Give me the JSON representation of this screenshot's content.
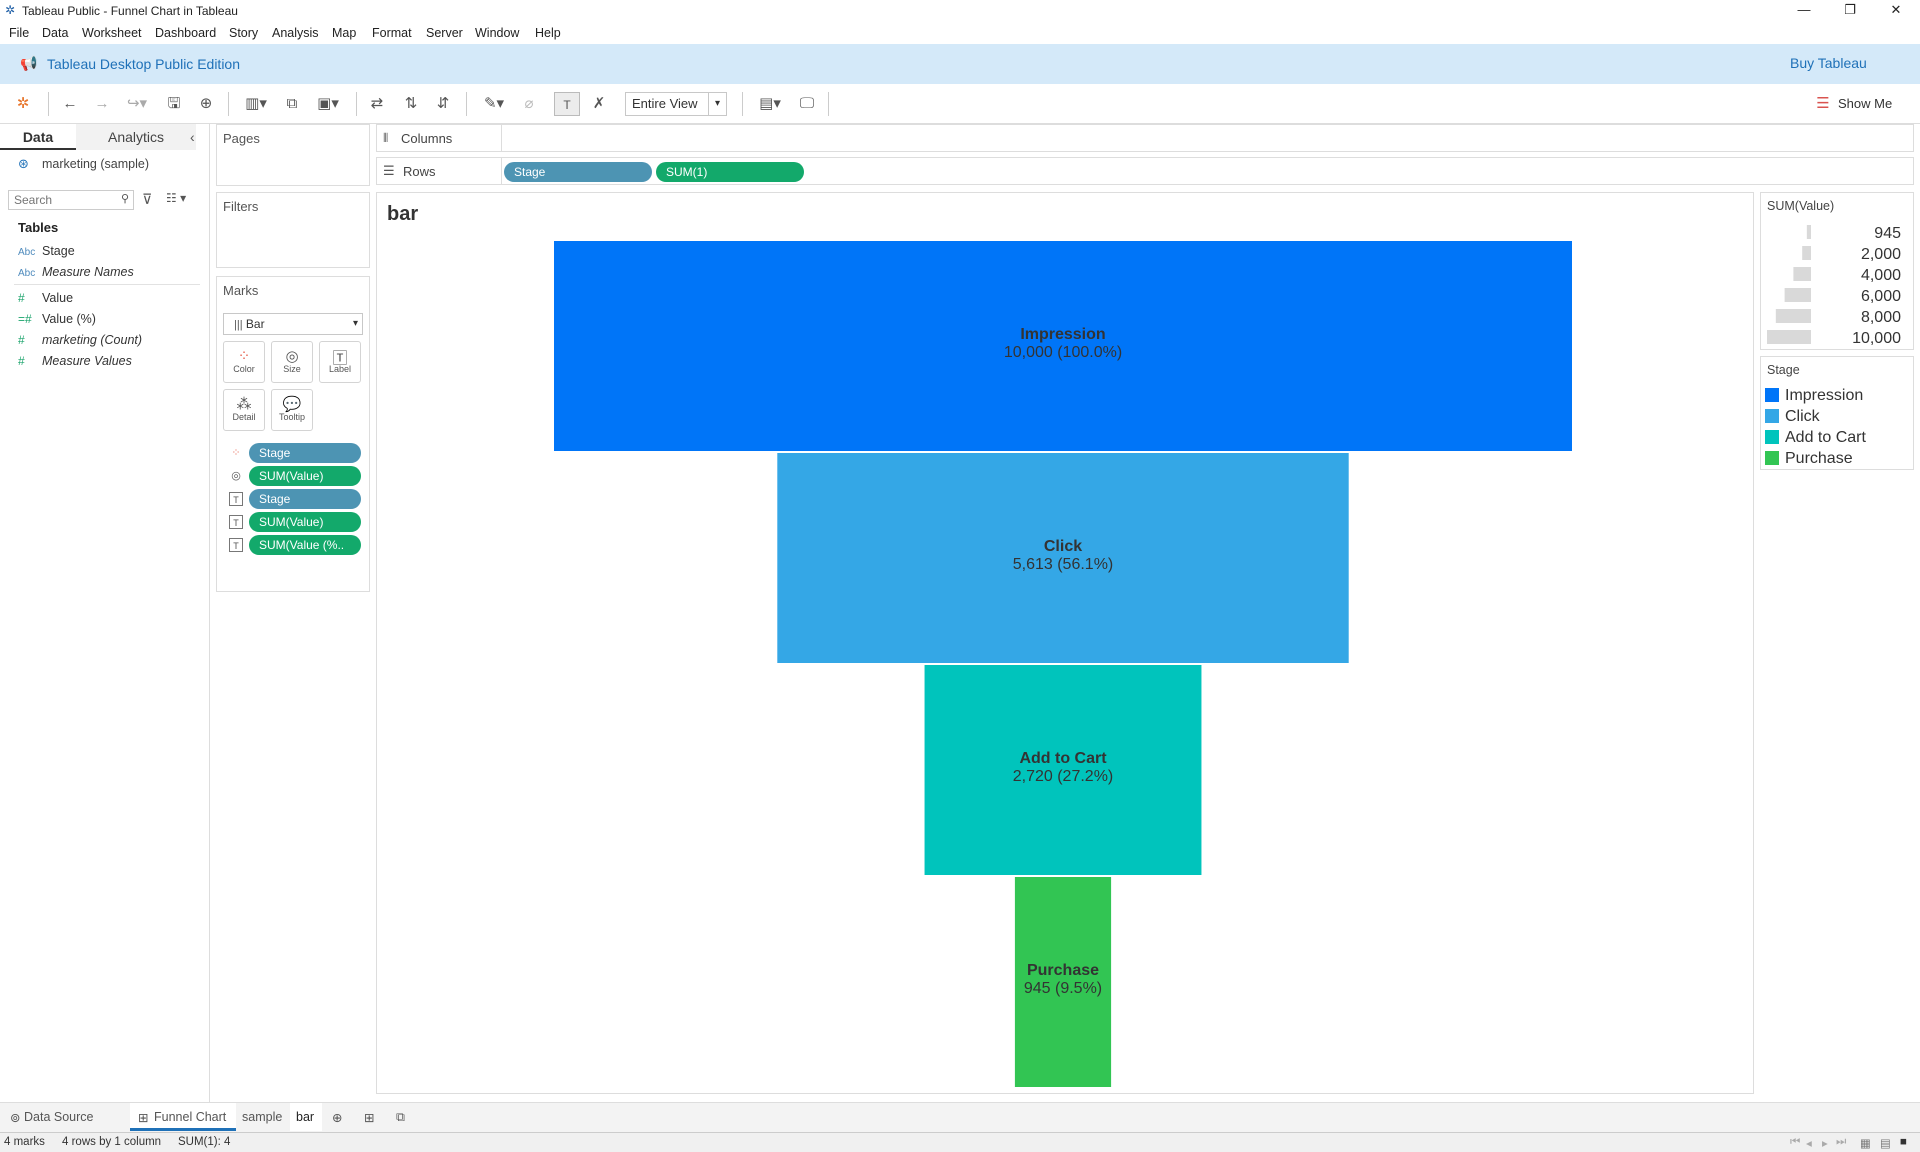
{
  "window": {
    "title": "Tableau Public - Funnel Chart in Tableau"
  },
  "menu": [
    "File",
    "Data",
    "Worksheet",
    "Dashboard",
    "Story",
    "Analysis",
    "Map",
    "Format",
    "Server",
    "Window",
    "Help"
  ],
  "banner": {
    "edition": "Tableau Desktop Public Edition",
    "buy": "Buy Tableau"
  },
  "toolbar": {
    "fit": "Entire View",
    "show_me": "Show Me"
  },
  "datapane": {
    "tab_data": "Data",
    "tab_analytics": "Analytics",
    "datasource": "marketing (sample)",
    "search_placeholder": "Search",
    "tables_header": "Tables",
    "dims": [
      {
        "type": "Abc",
        "name": "Stage"
      },
      {
        "type": "Abc",
        "name": "Measure Names"
      }
    ],
    "measures": [
      {
        "name": "Value"
      },
      {
        "name": "Value (%)"
      },
      {
        "name": "marketing (Count)"
      },
      {
        "name": "Measure Values"
      }
    ]
  },
  "cards": {
    "pages": "Pages",
    "filters": "Filters",
    "marks": "Marks",
    "mark_type": "Bar",
    "buttons": [
      "Color",
      "Size",
      "Label",
      "Detail",
      "Tooltip"
    ],
    "mark_pills": [
      "Stage",
      "SUM(Value)",
      "Stage",
      "SUM(Value)",
      "SUM(Value (%.."
    ]
  },
  "shelves": {
    "columns": "Columns",
    "rows": "Rows",
    "row_pills": [
      "Stage",
      "SUM(1)"
    ]
  },
  "sheet_title": "bar",
  "chart_data": {
    "type": "bar",
    "categories": [
      "Impression",
      "Click",
      "Add to Cart",
      "Purchase"
    ],
    "values": [
      10000,
      5613,
      2720,
      945
    ],
    "labels": [
      "10,000 (100.0%)",
      "5,613 (56.1%)",
      "2,720 (27.2%)",
      "945 (9.5%)"
    ],
    "colors": [
      "#0075f8",
      "#34a7e6",
      "#00c4bc",
      "#32c553"
    ],
    "max": 10000
  },
  "legends": {
    "size": {
      "title": "SUM(Value)",
      "items": [
        "945",
        "2,000",
        "4,000",
        "6,000",
        "8,000",
        "10,000"
      ],
      "values": [
        945,
        2000,
        4000,
        6000,
        8000,
        10000
      ]
    },
    "color": {
      "title": "Stage",
      "items": [
        "Impression",
        "Click",
        "Add to Cart",
        "Purchase"
      ]
    }
  },
  "sheets": {
    "datasource": "Data Source",
    "tabs": [
      "Funnel Chart",
      "sample",
      "bar"
    ]
  },
  "status": {
    "marks": "4 marks",
    "dims": "4 rows by 1 column",
    "sum": "SUM(1): 4"
  }
}
